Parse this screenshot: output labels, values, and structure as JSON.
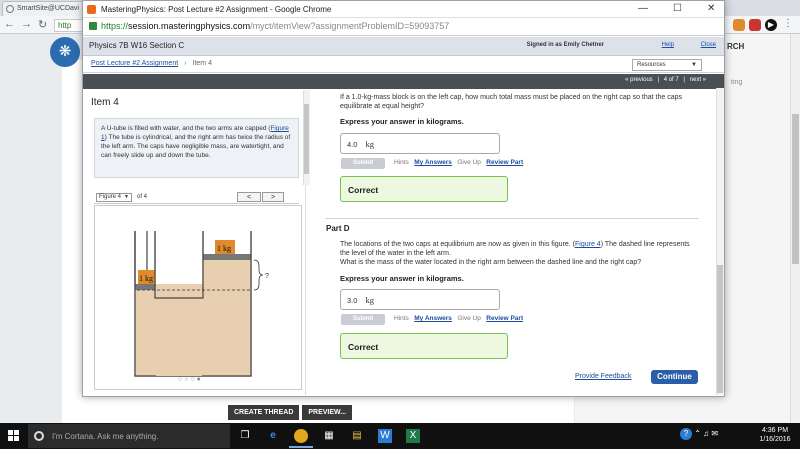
{
  "background_browser": {
    "tab_title": "SmartSite@UCDavi",
    "url_stub": "http",
    "search_fragment": "RCH",
    "setting_fragment": "ting",
    "buttons": [
      "CREATE THREAD",
      "PREVIEW..."
    ]
  },
  "window": {
    "title": "MasteringPhysics: Post Lecture #2 Assignment - Google Chrome",
    "controls": [
      "—",
      "☐",
      "✕"
    ],
    "url": {
      "protocol": "https://",
      "host": "session.masteringphysics.com",
      "path": "/myct/itemView?assignmentProblemID=59093757"
    }
  },
  "course": {
    "name": "Physics 7B W16 Section C",
    "signed_in": "Signed in as Emily Chetner",
    "help": "Help",
    "close": "Close"
  },
  "breadcrumb": {
    "assignment": "Post Lecture #2 Assignment",
    "separator": "›",
    "current": "Item 4",
    "resources": "Resources"
  },
  "pager": {
    "previous": "« previous",
    "position": "4 of 7",
    "next": "next »"
  },
  "item": {
    "title": "Item 4",
    "intro_part1": "A U-tube is filled with water, and the two arms are capped (",
    "intro_link": "Figure 1",
    "intro_part2": ") The tube is cylindrical, and the right arm has twice the radius of the left arm. The caps have negligible mass, are watertight, and can freely slide up and down the tube."
  },
  "figure": {
    "select": "Figure 4",
    "of": "of 4",
    "prev": "<",
    "next": ">",
    "label_left": "1 kg",
    "label_right": "1 kg",
    "question_mark": "?",
    "dots": "○○○●"
  },
  "part_c": {
    "question": "If a 1.0-kg-mass block is on the left cap, how much total mass must be placed on the right cap so that the caps equilibrate at equal height?",
    "express": "Express your answer in kilograms.",
    "answer": "4.0",
    "unit": "kg",
    "submit": "Submit",
    "hints": "Hints",
    "my_answers": "My Answers",
    "give_up": "Give Up",
    "review_part": "Review Part",
    "result": "Correct"
  },
  "part_d": {
    "label": "Part D",
    "q1": "The locations of the two caps at equilibrium are now as given in this figure. (",
    "q_link": "Figure 4",
    "q2": ") The dashed line represents the level of the water in the left arm.",
    "q3": "What is the mass of the water located in the right arm between the dashed line and the right cap?",
    "express": "Express your answer in kilograms.",
    "answer": "3.0",
    "unit": "kg",
    "submit": "Submit",
    "hints": "Hints",
    "my_answers": "My Answers",
    "give_up": "Give Up",
    "review_part": "Review Part",
    "result": "Correct"
  },
  "footer": {
    "feedback": "Provide Feedback",
    "continue": "Continue"
  },
  "taskbar": {
    "cortana": "I'm Cortana. Ask me anything.",
    "time": "4:36 PM",
    "date": "1/16/2016"
  }
}
